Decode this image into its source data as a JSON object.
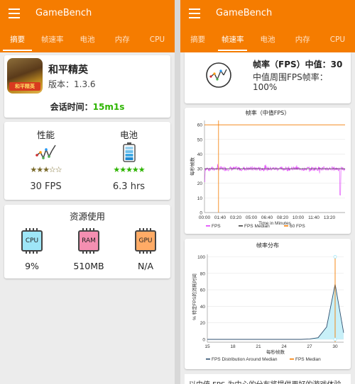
{
  "app_title": "GameBench",
  "tabs": [
    "摘要",
    "帧速率",
    "电池",
    "内存",
    "CPU"
  ],
  "left": {
    "active_tab": 0,
    "game": {
      "name": "和平精英",
      "version": "版本：1.3.6",
      "icon_label": "和平精英"
    },
    "session": {
      "label": "会话时间：",
      "value": "15m1s"
    },
    "performance": {
      "label": "性能",
      "value": "30 FPS",
      "stars": "★★★☆☆"
    },
    "battery": {
      "label": "电池",
      "value": "6.3 hrs",
      "stars": "★★★★★"
    },
    "resources": {
      "title": "资源使用",
      "cpu": {
        "chip": "CPU",
        "value": "9%"
      },
      "ram": {
        "chip": "RAM",
        "value": "510MB"
      },
      "gpu": {
        "chip": "GPU",
        "value": "N/A"
      }
    }
  },
  "right": {
    "active_tab": 1,
    "summary": {
      "line1": "帧率（FPS）中值：30",
      "line2": "中值周围FPS帧率：",
      "line3": "100%"
    },
    "footer_text": "以中值 FPS 为中心的分布将提供更好的游戏体验。"
  },
  "colors": {
    "brand": "#f57c00",
    "fps": "#e040fb",
    "median": "#424242",
    "target": "#f57c00",
    "good": "#2db400"
  },
  "chart_data": [
    {
      "type": "line",
      "title": "帧率（中值FPS）",
      "xlabel": "Time in Minutes",
      "ylabel": "每秒帧数",
      "x_ticks": [
        "00:00",
        "01:40",
        "03:20",
        "05:00",
        "06:40",
        "08:20",
        "10:00",
        "11:40",
        "13:20"
      ],
      "y_ticks": [
        0,
        10,
        20,
        30,
        40,
        50,
        60
      ],
      "ylim": [
        0,
        63
      ],
      "xlim": [
        0,
        15
      ],
      "series": [
        {
          "name": "FPS",
          "value": 30,
          "noise": 1.5,
          "start_dip": 21,
          "end_dip": 12
        },
        {
          "name": "FPS Median",
          "value": 30
        },
        {
          "name": "60 FPS",
          "value": 60
        }
      ],
      "marker_x": 1.5,
      "legend": "bottom"
    },
    {
      "type": "area",
      "title": "帧率分布",
      "xlabel": "每秒帧数",
      "ylabel": "% 特定FPS的消耗时间",
      "x": [
        15,
        16,
        17,
        18,
        19,
        20,
        21,
        22,
        23,
        24,
        25,
        26,
        27,
        28,
        29,
        30,
        31
      ],
      "values": [
        0,
        0,
        0,
        0,
        0,
        0,
        0,
        0,
        0,
        0,
        0,
        0,
        0.5,
        2,
        15,
        67,
        8
      ],
      "x_ticks": [
        15,
        18,
        21,
        24,
        27,
        30
      ],
      "y_ticks": [
        0,
        20,
        40,
        60,
        80,
        100
      ],
      "ylim": [
        0,
        103
      ],
      "median": 30,
      "series": [
        {
          "name": "FPS Distribution Around Median"
        },
        {
          "name": "FPS Median"
        }
      ],
      "legend": "bottom"
    }
  ]
}
